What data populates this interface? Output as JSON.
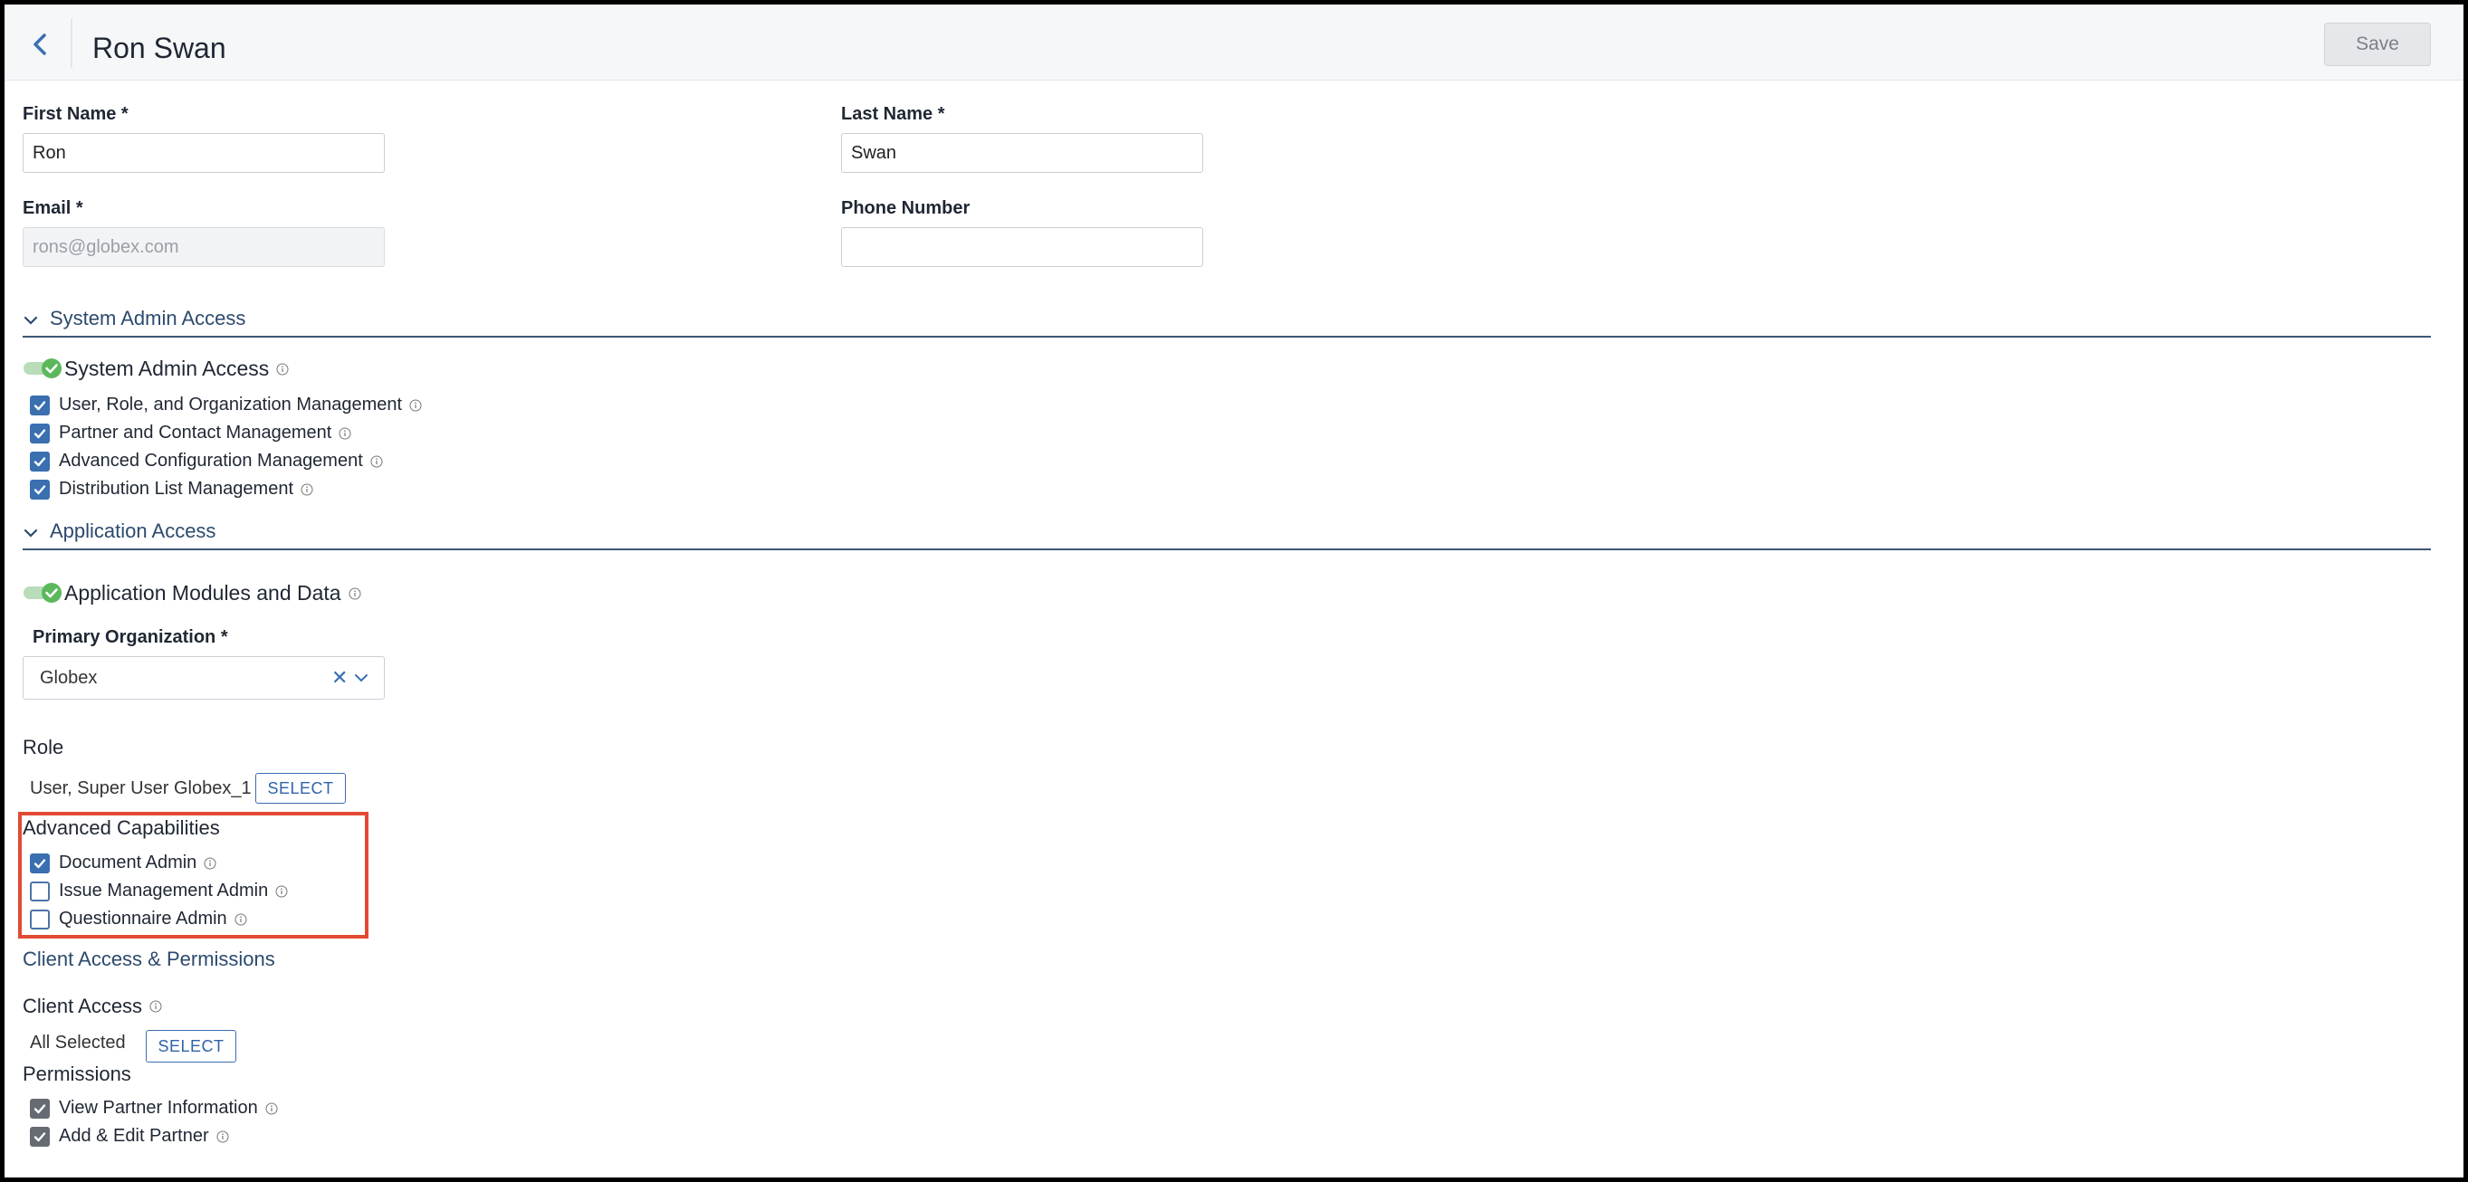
{
  "header": {
    "title": "Ron Swan",
    "save_label": "Save"
  },
  "form": {
    "first_name": {
      "label": "First Name *",
      "value": "Ron"
    },
    "last_name": {
      "label": "Last Name *",
      "value": "Swan"
    },
    "email": {
      "label": "Email *",
      "value": "rons@globex.com"
    },
    "phone": {
      "label": "Phone Number",
      "value": ""
    }
  },
  "system_admin_section": {
    "title": "System Admin Access",
    "toggle_label": "System Admin Access",
    "toggle_on": true,
    "items": [
      {
        "label": "User, Role, and Organization Management",
        "checked": true
      },
      {
        "label": "Partner and Contact Management",
        "checked": true
      },
      {
        "label": "Advanced Configuration Management",
        "checked": true
      },
      {
        "label": "Distribution List Management",
        "checked": true
      }
    ]
  },
  "application_section": {
    "title": "Application Access",
    "toggle_label": "Application Modules and Data",
    "toggle_on": true,
    "primary_org": {
      "label": "Primary Organization *",
      "value": "Globex"
    },
    "role": {
      "heading": "Role",
      "value": "User, Super User Globex_1",
      "select_label": "SELECT"
    },
    "advanced": {
      "heading": "Advanced Capabilities",
      "items": [
        {
          "label": "Document Admin",
          "checked": true
        },
        {
          "label": "Issue Management Admin",
          "checked": false
        },
        {
          "label": "Questionnaire Admin",
          "checked": false
        }
      ]
    }
  },
  "client_section": {
    "title": "Client Access & Permissions",
    "client_access": {
      "heading": "Client Access",
      "value": "All Selected",
      "select_label": "SELECT"
    },
    "permissions": {
      "heading": "Permissions",
      "items": [
        {
          "label": "View Partner Information",
          "checked": true
        },
        {
          "label": "Add & Edit Partner",
          "checked": true
        }
      ]
    }
  },
  "colors": {
    "accent": "#3a6fb0",
    "section": "#2c4a6e",
    "toggle": "#5cb85c",
    "highlight": "#e24a33"
  }
}
